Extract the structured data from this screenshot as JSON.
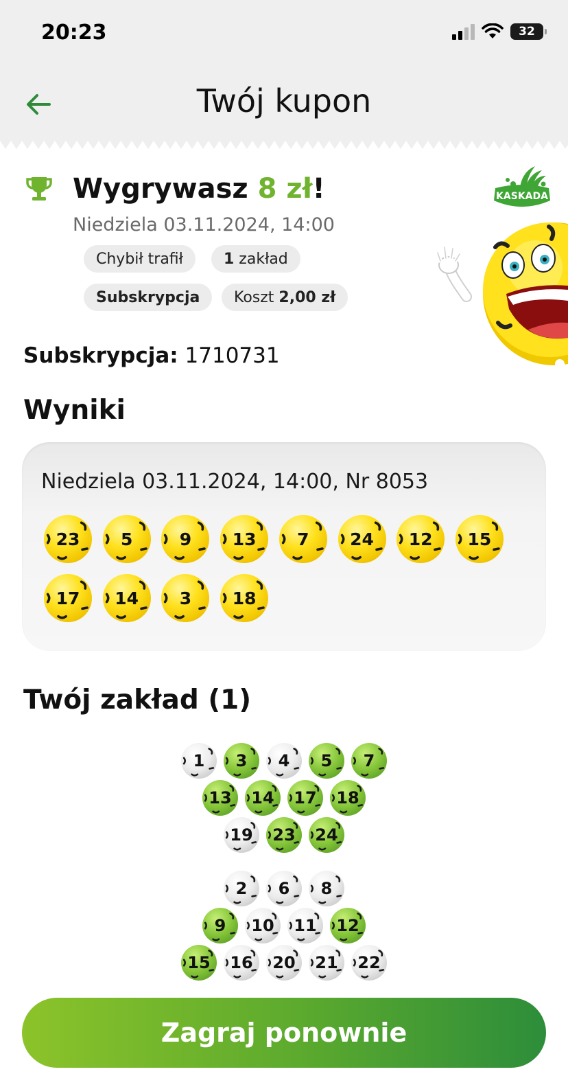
{
  "status_bar": {
    "time": "20:23",
    "battery": "32"
  },
  "header": {
    "title": "Twój kupon"
  },
  "summary": {
    "win_prefix": "Wygrywasz ",
    "win_amount": "8 zł",
    "win_suffix": "!",
    "date": "Niedziela 03.11.2024, 14:00",
    "chips": {
      "type": "Chybił trafił",
      "bets_count": "1",
      "bets_label": " zakład",
      "subscription": "Subskrypcja",
      "cost_label": "Koszt ",
      "cost_value": "2,00 zł"
    },
    "logo_text": "KASKADA"
  },
  "subscription": {
    "label": "Subskrypcja:",
    "number": " 1710731"
  },
  "results": {
    "heading": "Wyniki",
    "draw_info": "Niedziela 03.11.2024, 14:00, Nr 8053",
    "numbers": [
      "23",
      "5",
      "9",
      "13",
      "7",
      "24",
      "12",
      "15",
      "17",
      "14",
      "3",
      "18"
    ]
  },
  "bet": {
    "heading": "Twój zakład (1)",
    "balls": [
      {
        "n": "1",
        "hit": false
      },
      {
        "n": "3",
        "hit": true
      },
      {
        "n": "4",
        "hit": false
      },
      {
        "n": "5",
        "hit": true
      },
      {
        "n": "7",
        "hit": true
      },
      {
        "n": "13",
        "hit": true
      },
      {
        "n": "14",
        "hit": true
      },
      {
        "n": "17",
        "hit": true
      },
      {
        "n": "18",
        "hit": true
      },
      {
        "n": "19",
        "hit": false
      },
      {
        "n": "23",
        "hit": true
      },
      {
        "n": "24",
        "hit": true
      },
      {
        "n": "2",
        "hit": false
      },
      {
        "n": "6",
        "hit": false
      },
      {
        "n": "8",
        "hit": false
      },
      {
        "n": "9",
        "hit": true
      },
      {
        "n": "10",
        "hit": false
      },
      {
        "n": "11",
        "hit": false
      },
      {
        "n": "12",
        "hit": true
      },
      {
        "n": "15",
        "hit": true
      },
      {
        "n": "16",
        "hit": false
      },
      {
        "n": "20",
        "hit": false
      },
      {
        "n": "21",
        "hit": false
      },
      {
        "n": "22",
        "hit": false
      }
    ]
  },
  "cta": {
    "label": "Zagraj ponownie"
  },
  "colors": {
    "accent_green": "#6fb32e",
    "ball_yellow": "#ffe11e",
    "ball_green": "#86c63a",
    "ball_white": "#ececec"
  }
}
